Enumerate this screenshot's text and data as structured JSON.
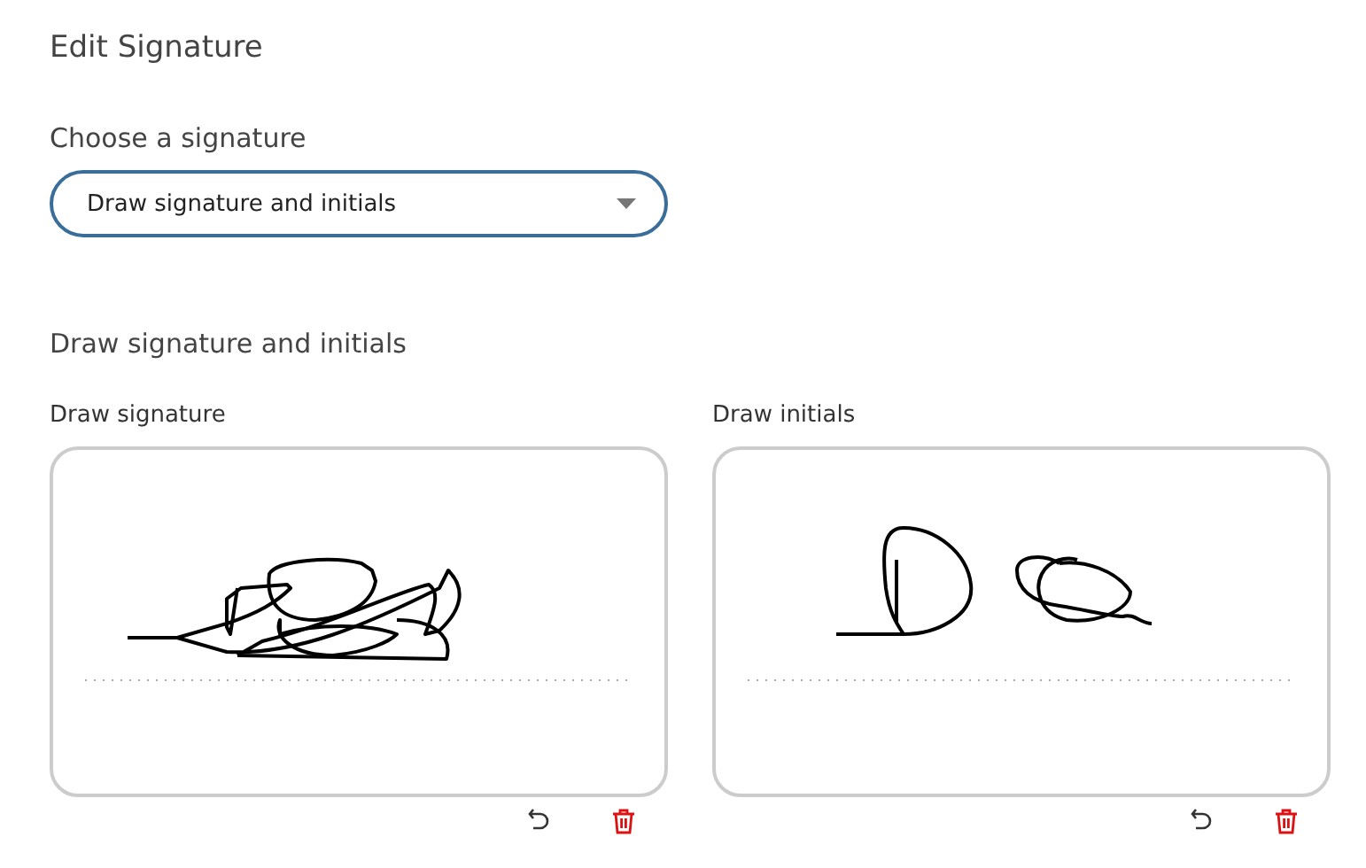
{
  "title": "Edit Signature",
  "chooser": {
    "label": "Choose a signature",
    "value": "Draw signature and initials"
  },
  "section_heading": "Draw signature and initials",
  "pads": [
    {
      "label": "Draw signature",
      "kind": "signature"
    },
    {
      "label": "Draw initials",
      "kind": "initials"
    }
  ]
}
